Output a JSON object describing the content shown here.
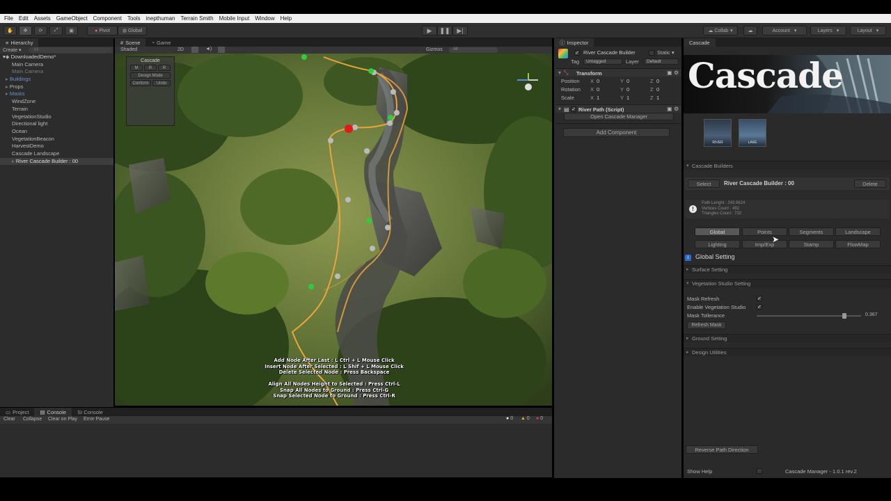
{
  "menu": [
    "File",
    "Edit",
    "Assets",
    "GameObject",
    "Component",
    "Tools",
    "inepthuman",
    "Terrain Smith",
    "Mobile Input",
    "Window",
    "Help"
  ],
  "toolbar": {
    "pivot": "Pivot",
    "global": "Global",
    "collab": "Collab",
    "account": "Account",
    "layers": "Layers",
    "layout": "Layout"
  },
  "hierarchy": {
    "tab": "Hierarchy",
    "create": "Create",
    "search_placeholder": "All",
    "scene_name": "DownloadedDemo*",
    "items": [
      {
        "label": "Main Camera",
        "style": "normal",
        "indent": 1
      },
      {
        "label": "Main Camera",
        "style": "dim",
        "indent": 1
      },
      {
        "label": "Buildings",
        "style": "blue",
        "indent": 1
      },
      {
        "label": "Props",
        "style": "normal",
        "indent": 1
      },
      {
        "label": "Masks",
        "style": "blue",
        "indent": 1
      },
      {
        "label": "WindZone",
        "style": "normal",
        "indent": 1
      },
      {
        "label": "Terrain",
        "style": "normal",
        "indent": 1
      },
      {
        "label": "VegetationStudio",
        "style": "normal",
        "indent": 1
      },
      {
        "label": "Directional light",
        "style": "normal",
        "indent": 1
      },
      {
        "label": "Ocean",
        "style": "normal",
        "indent": 1
      },
      {
        "label": "VegetationBeacon",
        "style": "normal",
        "indent": 1
      },
      {
        "label": "HarvestDemo",
        "style": "normal",
        "indent": 1
      },
      {
        "label": "Cascade Landscape",
        "style": "normal",
        "indent": 1
      },
      {
        "label": "River Cascade Builder : 00",
        "style": "sel",
        "indent": 2
      }
    ]
  },
  "scene": {
    "tab_scene": "Scene",
    "tab_game": "Game",
    "shaded": "Shaded",
    "mode_2d": "2D",
    "gizmos": "Gizmos",
    "gizmo_search": "All",
    "overlay": {
      "title": "Cascade",
      "buttons": [
        "M",
        "R",
        "R"
      ],
      "design_mode": "Design Mode",
      "conform": "Conform",
      "undo": "Undo"
    },
    "hints": [
      "Add Node After Last : L Ctrl + L Mouse Click",
      "Insert Node After Selected : L Shif + L Mouse Click",
      "Delete Selected Node : Press Backspace",
      "",
      "Align All Nodes Height to Selected : Press Ctrl-L",
      "Snap All Nodes to Ground : Press Ctrl-G",
      "Snap Selected Node to Ground : Press Ctrl-R"
    ]
  },
  "console": {
    "tab_project": "Project",
    "tab_console": "Console",
    "tab_sl": "SI Console",
    "clear": "Clear",
    "collapse": "Collapse",
    "clear_on_play": "Clear on Play",
    "error_pause": "Error Pause",
    "counts": [
      "0",
      "0",
      "0"
    ]
  },
  "inspector": {
    "tab": "Inspector",
    "object_name": "River Cascade Builder",
    "static": "Static",
    "tag_label": "Tag",
    "tag_value": "Untagged",
    "layer_label": "Layer",
    "layer_value": "Default",
    "transform": "Transform",
    "position": "Position",
    "rotation": "Rotation",
    "scale": "Scale",
    "pos": {
      "x": "0",
      "y": "0",
      "z": "0"
    },
    "rot": {
      "x": "0",
      "y": "0",
      "z": "0"
    },
    "scl": {
      "x": "1",
      "y": "1",
      "z": "1"
    },
    "axis_x": "X",
    "axis_y": "Y",
    "axis_z": "Z",
    "script": "River Path (Script)",
    "open_manager": "Open Cascade Manager",
    "add_component": "Add Component"
  },
  "cascade": {
    "tab": "Cascade",
    "banner_title": "Cascade",
    "thumb_river": "RIVER",
    "thumb_lake": "LAKE",
    "builders_section": "Cascade Builders",
    "select": "Select",
    "builder_name": "River Cascade Builder : 00",
    "delete": "Delete",
    "stats": [
      "Path Lenght : 243.9624",
      "Vertices Count : 492",
      "Triangles Count : 732"
    ],
    "tabs_row1": [
      "Global",
      "Points",
      "Segments",
      "Landscape"
    ],
    "tabs_row2": [
      "Lighting",
      "Imp/Exp",
      "Stamp",
      "FlowMap"
    ],
    "selected_tab": "Global",
    "global_setting": "Global Setting",
    "surface_setting": "Surface Setting",
    "veg_setting": "Vegetation Studio Setting",
    "mask_refresh": "Mask Refresh",
    "enable_veg": "Enable Vegetation Studio",
    "mask_tollerance": "Mask Tollerance",
    "mask_tollerance_value": "0.367",
    "mask_tollerance_level": 0.367,
    "refresh_mask": "Refresh Mask",
    "ground_setting": "Ground Setting",
    "design_utilities": "Design Utilities",
    "reverse_path": "Reverse Path Direction",
    "show_help": "Show Help",
    "version": "Cascade Manager - 1.0.1 rev.2"
  }
}
